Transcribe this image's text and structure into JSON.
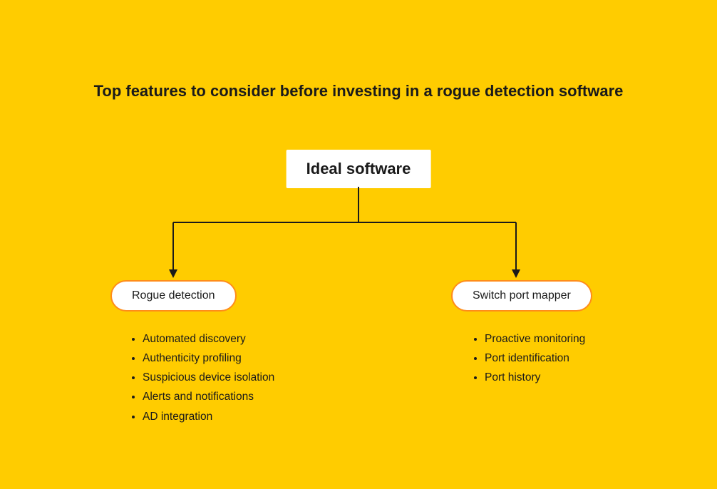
{
  "title": "Top features to consider before investing in a rogue detection software",
  "root": {
    "label": "Ideal software"
  },
  "branches": {
    "left": {
      "label": "Rogue detection",
      "features": [
        "Automated discovery",
        "Authenticity profiling",
        "Suspicious device isolation",
        "Alerts and notifications",
        "AD integration"
      ]
    },
    "right": {
      "label": "Switch port mapper",
      "features": [
        "Proactive monitoring",
        "Port identification",
        "Port history"
      ]
    }
  },
  "colors": {
    "background": "#FFCC00",
    "box_bg": "#FFFFFF",
    "pill_border": "#ff8c1a",
    "text": "#1a1a1a",
    "connector": "#1a1a1a"
  }
}
